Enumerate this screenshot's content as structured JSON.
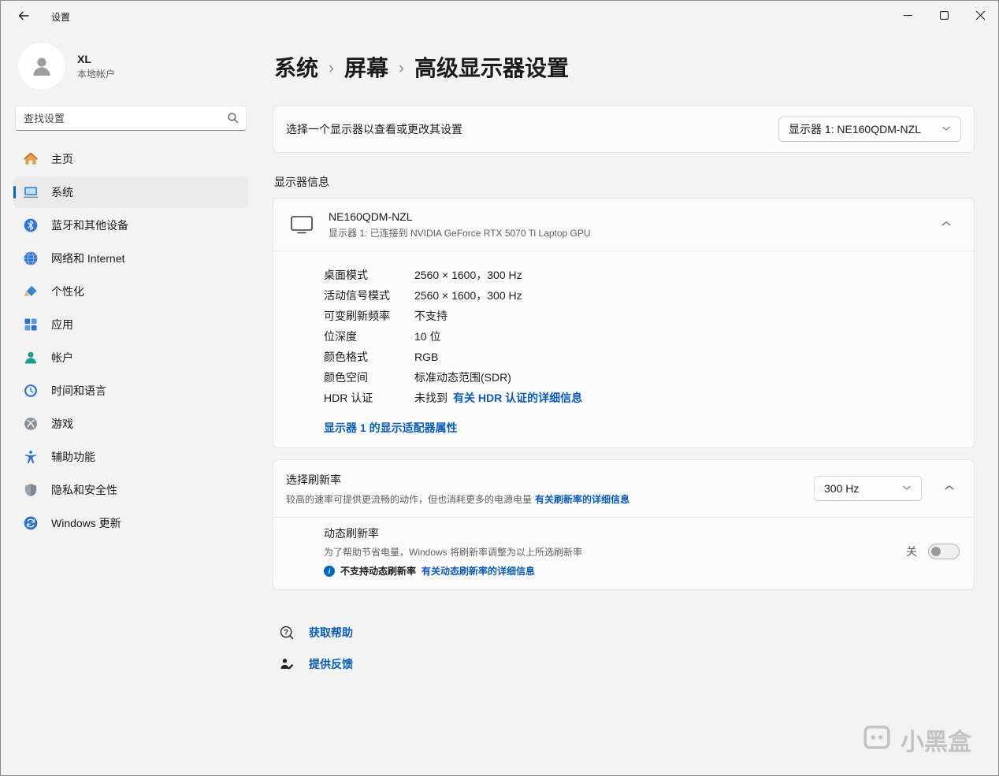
{
  "window": {
    "title": "设置"
  },
  "sidebar": {
    "user": {
      "name": "XL",
      "type": "本地帐户"
    },
    "search_placeholder": "查找设置",
    "items": [
      {
        "label": "主页"
      },
      {
        "label": "系统"
      },
      {
        "label": "蓝牙和其他设备"
      },
      {
        "label": "网络和 Internet"
      },
      {
        "label": "个性化"
      },
      {
        "label": "应用"
      },
      {
        "label": "帐户"
      },
      {
        "label": "时间和语言"
      },
      {
        "label": "游戏"
      },
      {
        "label": "辅助功能"
      },
      {
        "label": "隐私和安全性"
      },
      {
        "label": "Windows 更新"
      }
    ]
  },
  "breadcrumb": {
    "parts": [
      "系统",
      "屏幕",
      "高级显示器设置"
    ],
    "separator": "›"
  },
  "select_display": {
    "label": "选择一个显示器以查看或更改其设置",
    "value": "显示器 1: NE160QDM-NZL"
  },
  "display_info": {
    "section_title": "显示器信息",
    "name": "NE160QDM-NZL",
    "connection": "显示器 1: 已连接到 NVIDIA GeForce RTX 5070 Ti Laptop GPU",
    "rows": [
      {
        "label": "桌面模式",
        "value": "2560 × 1600，300 Hz"
      },
      {
        "label": "活动信号模式",
        "value": "2560 × 1600，300 Hz"
      },
      {
        "label": "可变刷新频率",
        "value": "不支持"
      },
      {
        "label": "位深度",
        "value": "10 位"
      },
      {
        "label": "颜色格式",
        "value": "RGB"
      },
      {
        "label": "颜色空间",
        "value": "标准动态范围(SDR)"
      }
    ],
    "hdr": {
      "label": "HDR 认证",
      "value": "未找到",
      "link": "有关 HDR 认证的详细信息"
    },
    "adapter_link": "显示器 1 的显示适配器属性"
  },
  "refresh_rate": {
    "title": "选择刷新率",
    "description": "较高的速率可提供更流畅的动作，但也消耗更多的电源电量",
    "link": "有关刷新率的详细信息",
    "value": "300 Hz",
    "dynamic": {
      "title": "动态刷新率",
      "description": "为了帮助节省电量，Windows 将刷新率调整为以上所选刷新率",
      "unsupported": "不支持动态刷新率",
      "link": "有关动态刷新率的详细信息",
      "toggle_state": "关"
    }
  },
  "footer": {
    "help": "获取帮助",
    "feedback": "提供反馈"
  },
  "watermark": {
    "text": "小黑盒"
  }
}
